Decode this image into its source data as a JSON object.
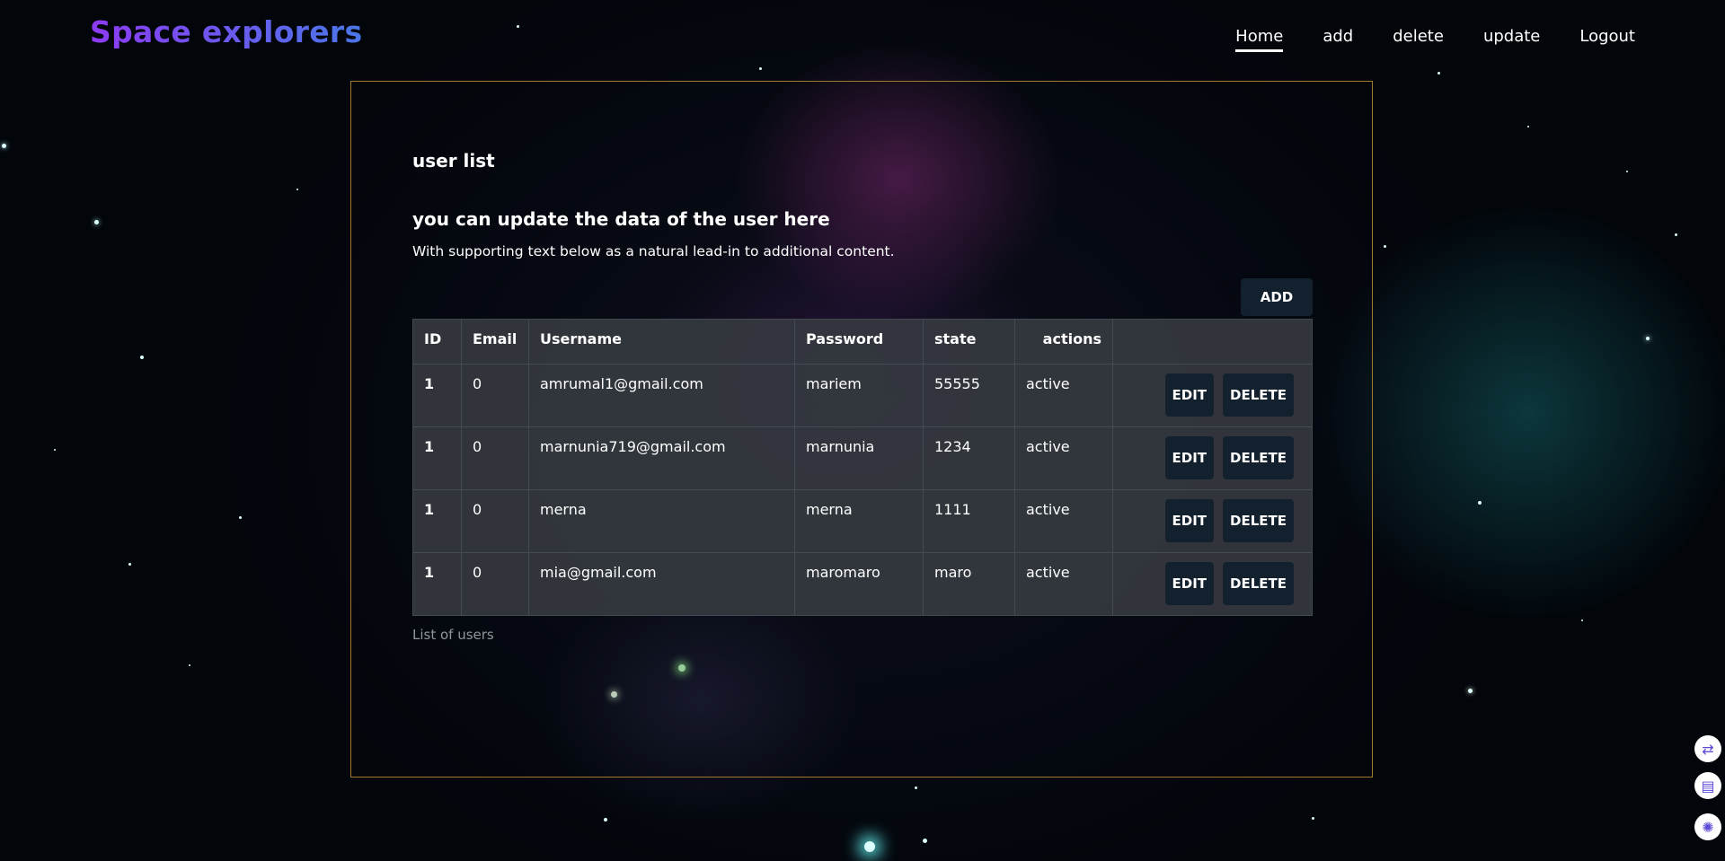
{
  "brand": "Space explorers",
  "nav": [
    {
      "label": "Home",
      "active": true
    },
    {
      "label": "add",
      "active": false
    },
    {
      "label": "delete",
      "active": false
    },
    {
      "label": "update",
      "active": false
    },
    {
      "label": "Logout",
      "active": false
    }
  ],
  "card": {
    "title": "user list",
    "heading": "you can update the data of the user here",
    "text": "With supporting text below as a natural lead-in to additional content.",
    "add_label": "ADD",
    "footer": "List of users"
  },
  "table": {
    "headers": [
      "ID",
      "Email",
      "Username",
      "Password",
      "state",
      "actions"
    ],
    "rows": [
      [
        "1",
        "0",
        "amrumal1@gmail.com",
        "mariem",
        "55555",
        "active"
      ],
      [
        "1",
        "0",
        "marnunia719@gmail.com",
        "marnunia",
        "1234",
        "active"
      ],
      [
        "1",
        "0",
        "merna",
        "merna",
        "1111",
        "active"
      ],
      [
        "1",
        "0",
        "mia@gmail.com",
        "maromaro",
        "maro",
        "active"
      ]
    ],
    "edit_label": "EDIT",
    "delete_label": "DELETE"
  },
  "side_widgets": [
    {
      "icon": "translate-icon"
    },
    {
      "icon": "book-icon"
    },
    {
      "icon": "brain-icon"
    }
  ],
  "colors": {
    "brand_gradient_start": "#8c3bf3",
    "brand_gradient_end": "#4a76e8",
    "card_border": "#a07a2e",
    "button_bg": "#13202e",
    "table_bg": "#34383e"
  }
}
